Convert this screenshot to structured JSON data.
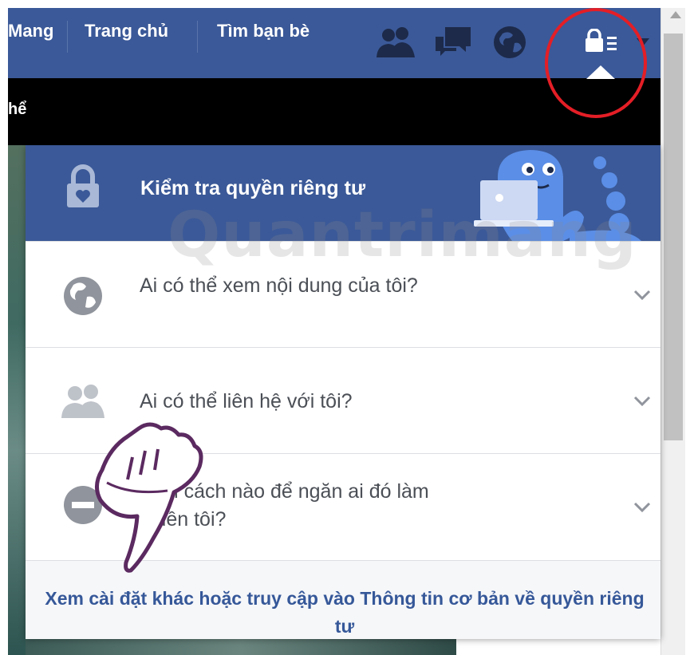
{
  "topbar": {
    "nav_items": [
      "Mang",
      "Trang chủ",
      "Tìm bạn bè"
    ],
    "icons": [
      "friends-icon",
      "messages-icon",
      "notifications-globe-icon",
      "privacy-shortcuts-icon",
      "dropdown-caret-icon"
    ]
  },
  "background": {
    "fragment": "hể"
  },
  "privacy_menu": {
    "title": "Kiểm tra quyền riêng tư",
    "items": [
      {
        "label": "Ai có thể xem nội dung của tôi?",
        "icon": "globe-icon"
      },
      {
        "label": "Ai có thể liên hệ với tôi?",
        "icon": "people-icon"
      },
      {
        "label": "Làm cách nào để ngăn ai đó làm phiền tôi?",
        "icon": "block-icon"
      }
    ],
    "footer_link": "Xem cài đặt khác hoặc truy cập vào Thông tin cơ bản về quyền riêng tư"
  },
  "watermark": "Quantrimang",
  "colors": {
    "facebook_blue": "#3b5998",
    "link_blue": "#365899",
    "annotation_red": "#e41e26"
  }
}
